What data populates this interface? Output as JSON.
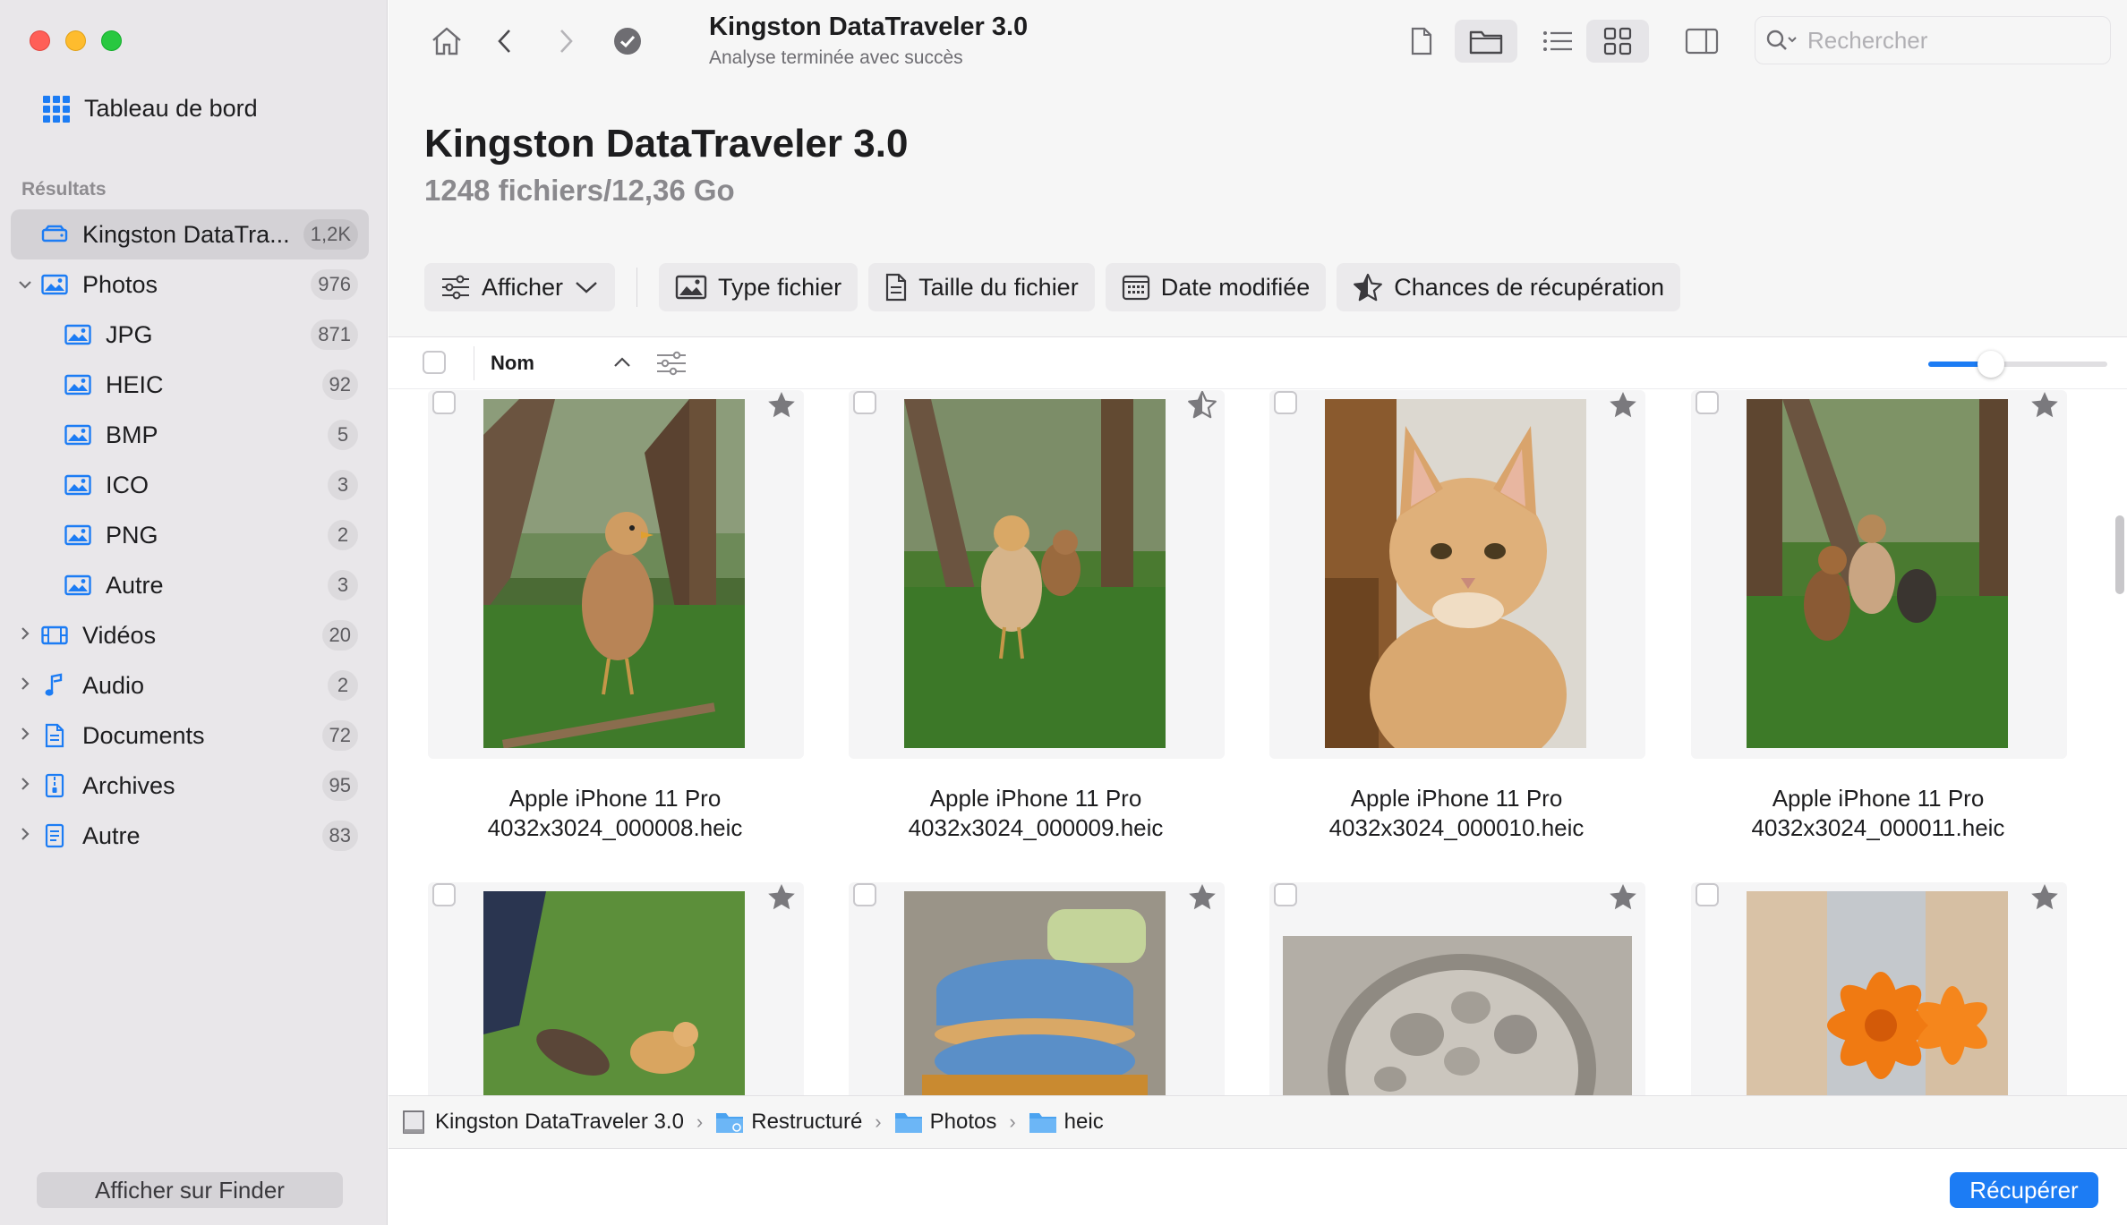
{
  "window": {
    "controls": [
      "close",
      "minimize",
      "zoom"
    ]
  },
  "sidebar": {
    "dashboard_label": "Tableau de bord",
    "section_label": "Résultats",
    "items": [
      {
        "label": "Kingston DataTra...",
        "count": "1,2K",
        "icon": "drive-icon",
        "selected": true
      },
      {
        "label": "Photos",
        "count": "976",
        "icon": "photo-icon",
        "expanded": true
      },
      {
        "label": "JPG",
        "count": "871",
        "icon": "photo-icon"
      },
      {
        "label": "HEIC",
        "count": "92",
        "icon": "photo-icon"
      },
      {
        "label": "BMP",
        "count": "5",
        "icon": "photo-icon"
      },
      {
        "label": "ICO",
        "count": "3",
        "icon": "photo-icon"
      },
      {
        "label": "PNG",
        "count": "2",
        "icon": "photo-icon"
      },
      {
        "label": "Autre",
        "count": "3",
        "icon": "photo-icon"
      },
      {
        "label": "Vidéos",
        "count": "20",
        "icon": "film-icon"
      },
      {
        "label": "Audio",
        "count": "2",
        "icon": "music-note-icon"
      },
      {
        "label": "Documents",
        "count": "72",
        "icon": "document-icon"
      },
      {
        "label": "Archives",
        "count": "95",
        "icon": "archive-icon"
      },
      {
        "label": "Autre",
        "count": "83",
        "icon": "document-icon"
      }
    ],
    "finder_button": "Afficher sur Finder"
  },
  "toolbar": {
    "title": "Kingston DataTraveler 3.0",
    "subtitle": "Analyse terminée avec succès",
    "search_placeholder": "Rechercher"
  },
  "header": {
    "title": "Kingston DataTraveler 3.0",
    "summary": "1248 fichiers/12,36 Go"
  },
  "filters": {
    "show": "Afficher",
    "file_type": "Type fichier",
    "file_size": "Taille du fichier",
    "date_modified": "Date modifiée",
    "recovery_chances": "Chances de récupération"
  },
  "columns": {
    "name": "Nom"
  },
  "zoom_level": 0.35,
  "files": [
    {
      "name_line1": "Apple iPhone 11 Pro",
      "name_line2": "4032x3024_000008.heic",
      "starred": "full"
    },
    {
      "name_line1": "Apple iPhone 11 Pro",
      "name_line2": "4032x3024_000009.heic",
      "starred": "half"
    },
    {
      "name_line1": "Apple iPhone 11 Pro",
      "name_line2": "4032x3024_000010.heic",
      "starred": "full"
    },
    {
      "name_line1": "Apple iPhone 11 Pro",
      "name_line2": "4032x3024_000011.heic",
      "starred": "full"
    },
    {
      "starred": "full"
    },
    {
      "starred": "full"
    },
    {
      "starred": "full"
    },
    {
      "starred": "full"
    }
  ],
  "path": [
    "Kingston DataTraveler 3.0",
    "Restructuré",
    "Photos",
    "heic"
  ],
  "recover_button": "Récupérer",
  "colors": {
    "accent": "#1c7cf4",
    "sidebar_bg": "#e9e7ea",
    "toolbar_bg": "#f6f6f6"
  }
}
